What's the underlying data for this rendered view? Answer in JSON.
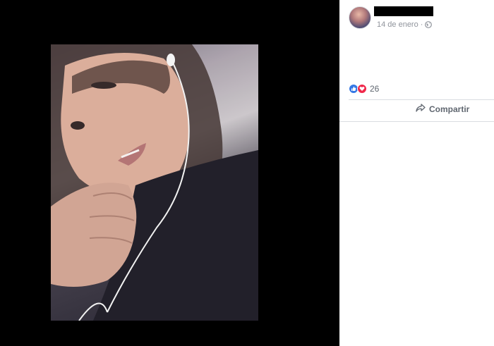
{
  "post": {
    "author_name": "",
    "date": "14 de enero",
    "separator": "·",
    "privacy_icon": "globe-icon"
  },
  "reactions": {
    "icons": [
      "like-icon",
      "love-icon"
    ],
    "count": "26"
  },
  "actions": {
    "share_label": "Compartir",
    "share_icon": "share-arrow-icon"
  },
  "colors": {
    "like": "#3578e5",
    "love": "#f0284a",
    "meta_text": "#90949c",
    "action_text": "#606770"
  }
}
